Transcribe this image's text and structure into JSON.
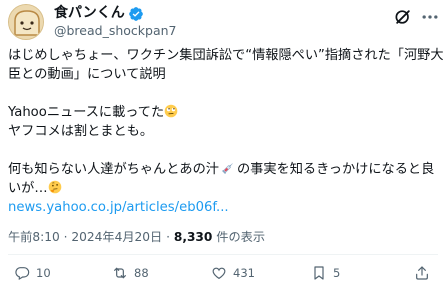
{
  "author": {
    "display_name": "食パンくん",
    "handle": "@bread_shockpan7",
    "verified": true
  },
  "header_icons": [
    "grok-icon",
    "more-icon"
  ],
  "tweet": {
    "line1": "はじめしゃちょー、ワクチン集団訴訟で“情報隠ぺい”指摘された「河野大",
    "line2": "臣との動画」について説明",
    "line3": "Yahooニュースに載ってた",
    "line4": "ヤフコメは割とまとも。",
    "line5a": "何も知らない人達がちゃんとあの汁",
    "line5b": "の事実を知るきっかけになると良",
    "line6": "いが…",
    "link": "news.yahoo.co.jp/articles/eb06f..."
  },
  "meta": {
    "time": "午前8:10",
    "sep1": " · ",
    "date": "2024年4月20日",
    "sep2": " · ",
    "views": "8,330",
    "views_label": " 件の表示"
  },
  "actions": {
    "reply_count": "10",
    "retweet_count": "88",
    "like_count": "431",
    "bookmark_count": "5"
  },
  "colors": {
    "text": "#0f1419",
    "secondary": "#536471",
    "link": "#1d9bf0",
    "verified": "#1d9bf0"
  }
}
